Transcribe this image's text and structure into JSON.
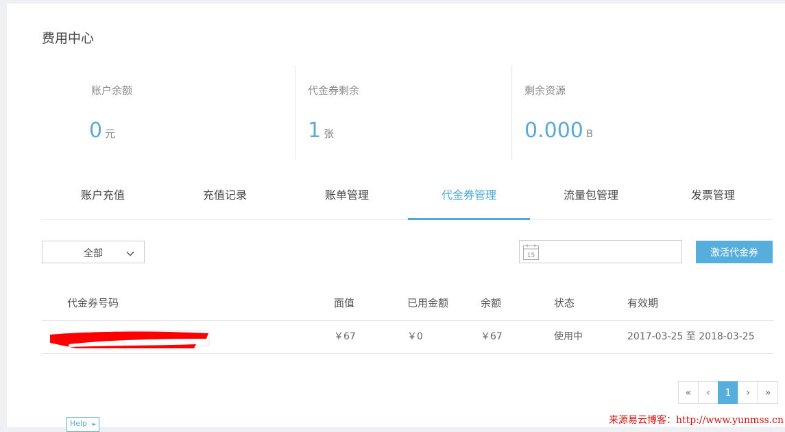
{
  "page": {
    "title": "费用中心"
  },
  "stats": [
    {
      "label": "账户余额",
      "value": "0",
      "unit": "元"
    },
    {
      "label": "代金券剩余",
      "value": "1",
      "unit": "张"
    },
    {
      "label": "剩余资源",
      "value": "0.000",
      "unit": "B"
    }
  ],
  "tabs": [
    {
      "label": "账户充值",
      "active": false
    },
    {
      "label": "充值记录",
      "active": false
    },
    {
      "label": "账单管理",
      "active": false
    },
    {
      "label": "代金券管理",
      "active": true
    },
    {
      "label": "流量包管理",
      "active": false
    },
    {
      "label": "发票管理",
      "active": false
    }
  ],
  "toolbar": {
    "filter_selected": "全部",
    "date_icon_day": "15",
    "activate_label": "激活代金券"
  },
  "table": {
    "headers": [
      "代金券号码",
      "面值",
      "已用金额",
      "余额",
      "状态",
      "有效期"
    ],
    "rows": [
      {
        "code": "",
        "face": "￥67",
        "used": "￥0",
        "balance": "￥67",
        "status": "使用中",
        "valid": "2017-03-25 至 2018-03-25"
      }
    ]
  },
  "pagination": {
    "first": "«",
    "prev": "‹",
    "current": "1",
    "next": "›",
    "last": "»"
  },
  "help": {
    "label": "Help"
  },
  "watermark": "来源易云博客：http://www.yunmss.cn",
  "colors": {
    "accent": "#55aedc",
    "redaction": "#ff0000",
    "watermark": "#d01010"
  }
}
